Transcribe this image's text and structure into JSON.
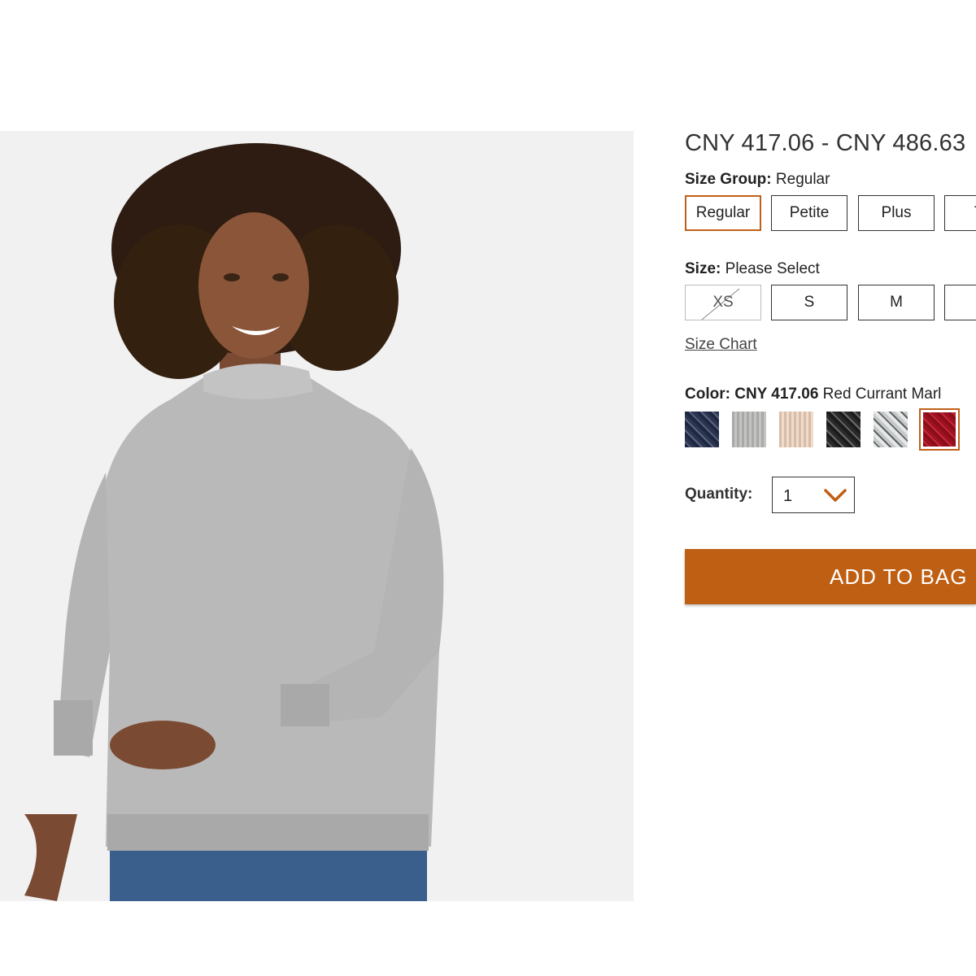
{
  "product": {
    "price_range": "CNY 417.06 - CNY 486.63",
    "image_alt": "Woman wearing gray marled mock-neck sweater"
  },
  "size_group": {
    "label": "Size Group:",
    "value": "Regular",
    "options": [
      "Regular",
      "Petite",
      "Plus",
      "T"
    ],
    "selected": "Regular"
  },
  "size": {
    "label": "Size:",
    "value": "Please Select",
    "options": [
      "XS",
      "S",
      "M",
      ""
    ],
    "unavailable": [
      "XS"
    ],
    "size_chart_link": "Size Chart"
  },
  "color": {
    "label": "Color:",
    "price": "CNY 417.06",
    "value": "Red Currant Marl",
    "swatches": [
      {
        "name": "Navy Marl",
        "color": "#2c3550"
      },
      {
        "name": "Gray Heather",
        "color": "#b3b3b1"
      },
      {
        "name": "Oatmeal Marl",
        "color": "#e2c9b6"
      },
      {
        "name": "Black Marl",
        "color": "#2a2a2a"
      },
      {
        "name": "Light Gray Marl",
        "color": "#c6c9ca"
      },
      {
        "name": "Red Currant Marl",
        "color": "#9e1120"
      }
    ],
    "selected_index": 5
  },
  "quantity": {
    "label": "Quantity:",
    "value": "1"
  },
  "actions": {
    "add_to_bag": "ADD TO BAG"
  },
  "colors": {
    "accent": "#bf5f14",
    "background": "#ffffff",
    "image_bg": "#f1f1f1"
  }
}
